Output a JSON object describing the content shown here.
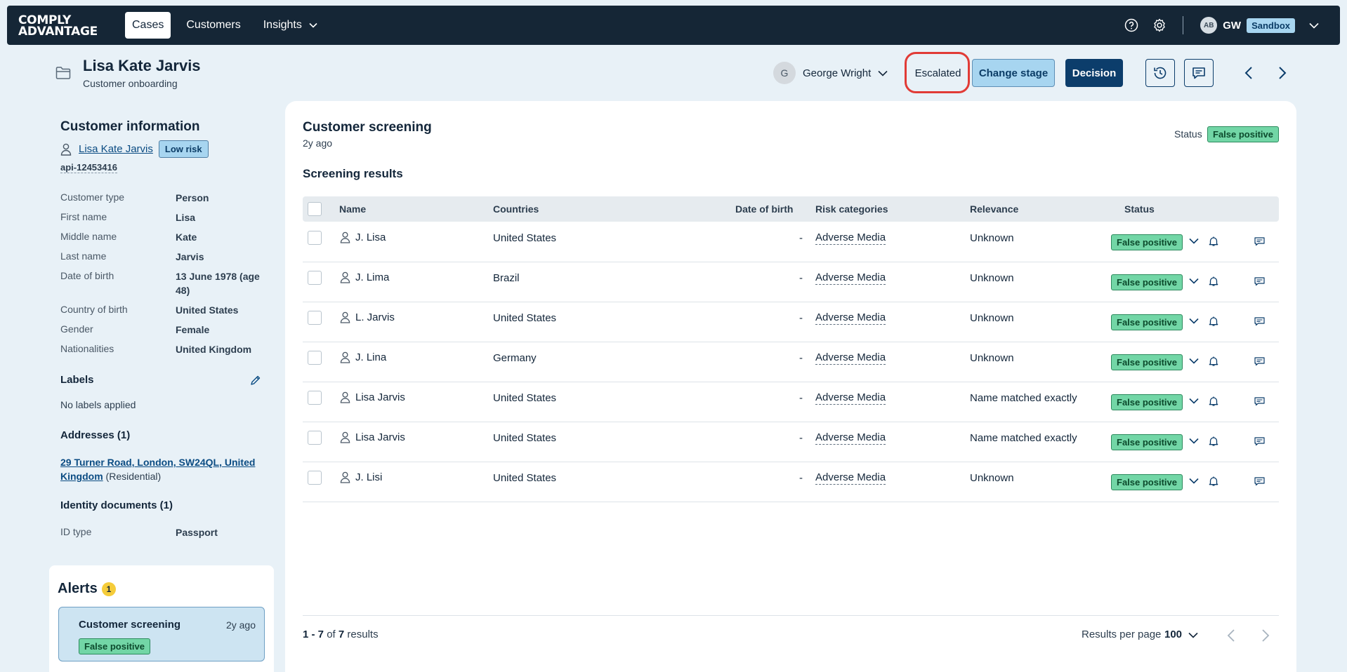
{
  "brand": {
    "line1": "COMPLY",
    "line2": "ADVANTAGE"
  },
  "nav": {
    "tabs": [
      {
        "label": "Cases",
        "active": true
      },
      {
        "label": "Customers",
        "active": false
      },
      {
        "label": "Insights",
        "active": false
      }
    ],
    "user_avatar": "AB",
    "user_initials": "GW",
    "environment": "Sandbox"
  },
  "case": {
    "title": "Lisa Kate Jarvis",
    "subtitle": "Customer onboarding",
    "assignee_initial": "G",
    "assignee": "George Wright",
    "stage": "Escalated",
    "change_stage_label": "Change stage",
    "decision_label": "Decision"
  },
  "customer": {
    "section_title": "Customer information",
    "name": "Lisa Kate Jarvis",
    "risk": "Low risk",
    "api_id": "api-12453416",
    "fields": [
      {
        "label": "Customer type",
        "value": "Person"
      },
      {
        "label": "First name",
        "value": "Lisa"
      },
      {
        "label": "Middle name",
        "value": "Kate"
      },
      {
        "label": "Last name",
        "value": "Jarvis"
      },
      {
        "label": "Date of birth",
        "value": "13 June 1978 (age 48)"
      },
      {
        "label": "Country of birth",
        "value": "United States"
      },
      {
        "label": "Gender",
        "value": "Female"
      },
      {
        "label": "Nationalities",
        "value": "United Kingdom"
      }
    ],
    "labels_title": "Labels",
    "labels_empty": "No labels applied",
    "addresses_title": "Addresses (1)",
    "address": "29 Turner Road, London, SW24QL, United Kingdom",
    "address_type": "(Residential)",
    "identity_title": "Identity documents (1)",
    "id_type_label": "ID type",
    "id_type_value": "Passport"
  },
  "alerts": {
    "title": "Alerts",
    "count": "1",
    "items": [
      {
        "title": "Customer screening",
        "ago": "2y ago",
        "status": "False positive"
      }
    ]
  },
  "screening": {
    "title": "Customer screening",
    "ago": "2y ago",
    "status_label": "Status",
    "status": "False positive",
    "results_title": "Screening results",
    "columns": [
      "Name",
      "Countries",
      "Date of birth",
      "Risk categories",
      "Relevance",
      "Status"
    ],
    "rows": [
      {
        "name": "J. Lisa",
        "country": "United States",
        "dob": "-",
        "risk": "Adverse Media",
        "relevance": "Unknown",
        "status": "False positive"
      },
      {
        "name": "J. Lima",
        "country": "Brazil",
        "dob": "-",
        "risk": "Adverse Media",
        "relevance": "Unknown",
        "status": "False positive"
      },
      {
        "name": "L. Jarvis",
        "country": "United States",
        "dob": "-",
        "risk": "Adverse Media",
        "relevance": "Unknown",
        "status": "False positive"
      },
      {
        "name": "J. Lina",
        "country": "Germany",
        "dob": "-",
        "risk": "Adverse Media",
        "relevance": "Unknown",
        "status": "False positive"
      },
      {
        "name": "Lisa Jarvis",
        "country": "United States",
        "dob": "-",
        "risk": "Adverse Media",
        "relevance": "Name matched exactly",
        "status": "False positive"
      },
      {
        "name": "Lisa Jarvis",
        "country": "United States",
        "dob": "-",
        "risk": "Adverse Media",
        "relevance": "Name matched exactly",
        "status": "False positive"
      },
      {
        "name": "J. Lisi",
        "country": "United States",
        "dob": "-",
        "risk": "Adverse Media",
        "relevance": "Unknown",
        "status": "False positive"
      }
    ],
    "pagination": {
      "range": "1 - 7",
      "of": "of",
      "total": "7",
      "suffix": "results",
      "per_page_label": "Results per page",
      "per_page": "100"
    }
  },
  "colors": {
    "nav_bg": "#152636",
    "page_bg": "#e8f1f7",
    "accent_dark": "#0c3d6b",
    "accent_light": "#a7d5f0",
    "positive_green": "#72d6a6",
    "escalated_ring": "#e13b36"
  }
}
